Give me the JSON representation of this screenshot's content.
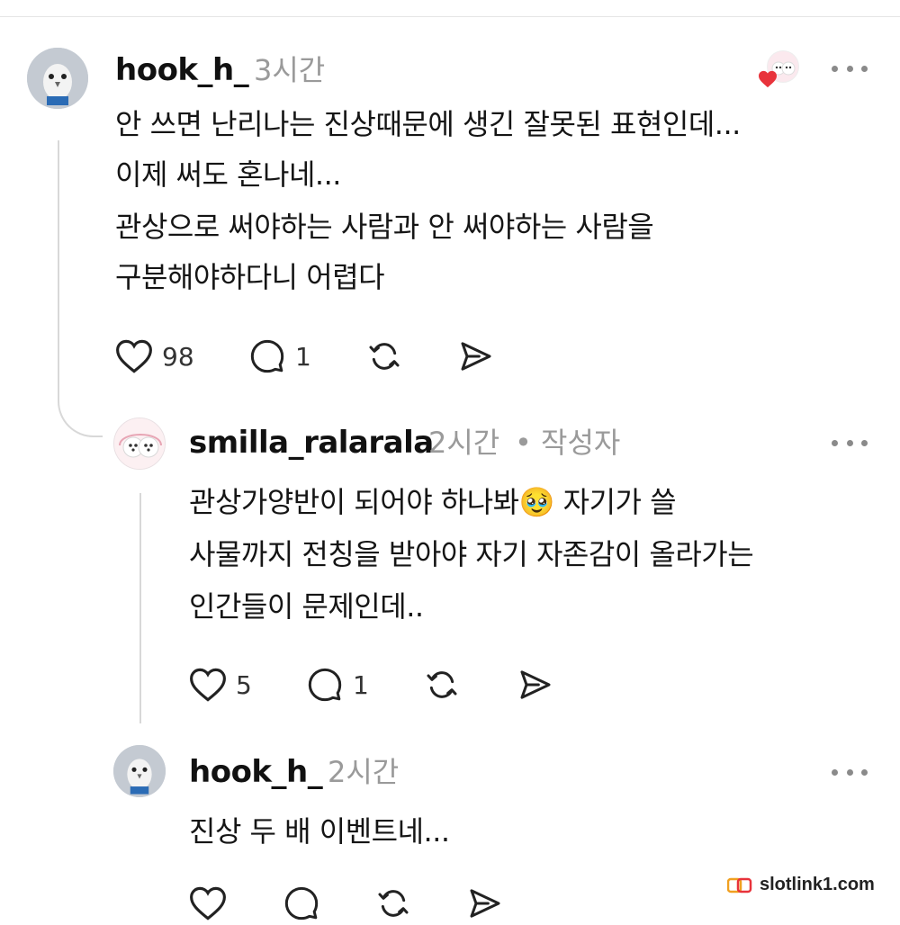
{
  "comments": [
    {
      "username": "hook_h_",
      "time": "3시간",
      "lines": [
        "안 쓰면 난리나는 진상때문에 생긴 잘못된 표현인데...",
        "이제 써도 혼나네...",
        "관상으로 써야하는 사람과 안 써야하는 사람을",
        "구분해야하다니 어렵다"
      ],
      "likes": "98",
      "replies": "1"
    },
    {
      "username": "smilla_ralarala",
      "time": "2시간",
      "author_badge": "• 작성자",
      "line1_pre": "관상가양반이 되어야 하나봐",
      "emoji": "🥹",
      "line1_post": " 자기가 쓸",
      "lines": [
        "사물까지 전칭을 받아야 자기 자존감이 올라가는",
        "인간들이 문제인데.."
      ],
      "likes": "5",
      "replies": "1"
    },
    {
      "username": "hook_h_",
      "time": "2시간",
      "lines": [
        "진상 두 배 이벤트네..."
      ]
    }
  ],
  "watermark": "slotlink1.com",
  "icons": [
    "heart-icon",
    "comment-icon",
    "repost-icon",
    "share-icon",
    "more-icon"
  ],
  "colors": {
    "heart_red": "#e8333b",
    "muted": "#9a9a9a",
    "thread": "#d8d8d8"
  }
}
